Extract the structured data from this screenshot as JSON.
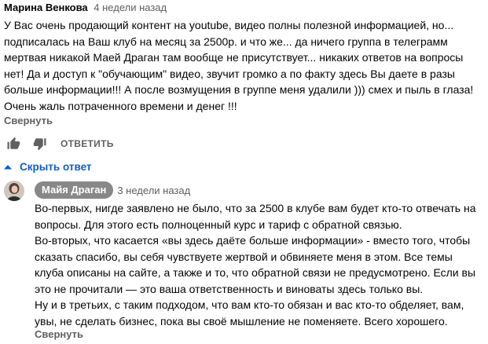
{
  "comment": {
    "author": "Марина Венкова",
    "time": "4 недели назад",
    "lines": [
      "У Вас очень продающий контент на youtube, видео полны полезной информацией, но...",
      "подписалась на  Ваш клуб на месяц за 2500р. и что же... да ничего группа в телеграмм",
      "мертвая никакой Маей Драган там вообще не присутствует... никаких ответов на вопросы",
      "нет! Да и доступ к \"обучающим\" видео, звучит громко а по факту  здесь Вы даете в разы",
      "больше информации!!!  А после возмущения в группе меня удалили ))) смех и пыль в глаза!",
      "Очень жаль потраченного времени и денег !!!"
    ],
    "collapse_label": "Свернуть",
    "reply_label": "ОТВЕТИТЬ",
    "icons": {
      "like": "thumb-up-icon",
      "dislike": "thumb-down-icon"
    }
  },
  "replies_toggle": {
    "label": "Скрыть ответ",
    "icon": "chevron-up-icon"
  },
  "reply": {
    "author": "Майя Драган",
    "time": "3 недели назад",
    "lines": [
      "Во-первых, нигде заявлено не было, что за 2500 в клубе вам будет кто-то отвечать на",
      "вопросы. Для этого есть полноценный курс и тариф с обратной связью.",
      "Во-вторых, что касается «вы здесь даёте больше информации» - вместо того, чтобы",
      "сказать спасибо, вы себя чувствуете жертвой и обвиняете меня в этом. Все темы",
      "клуба описаны на сайте, а также и то, что обратной связи не предусмотрено. Если вы",
      "это не прочитали — это ваша ответственность и виноваты здесь только вы.",
      "Ну и в третьих, с таким подходом, что вам кто-то обязан и вас кто-то обделяет, вам,",
      "увы, не сделать бизнес, пока вы своё мышление не поменяете. Всего хорошего."
    ],
    "collapse_label": "Свернуть"
  },
  "colors": {
    "link_blue": "#065fd4",
    "secondary_text": "#606060",
    "badge_bg": "#888888"
  }
}
